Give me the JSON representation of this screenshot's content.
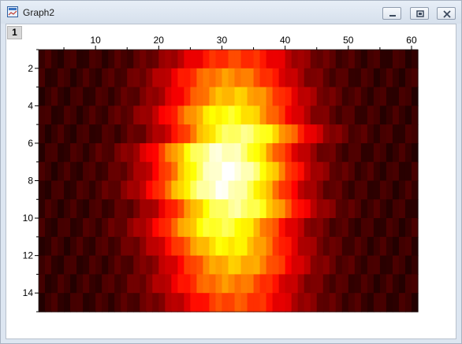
{
  "window": {
    "title": "Graph2",
    "layer_label": "1",
    "icon": "graph-window-icon",
    "buttons": [
      "minimize-icon",
      "restore-icon",
      "close-icon"
    ]
  },
  "chart_data": {
    "type": "heatmap",
    "title": "",
    "xlabel": "",
    "ylabel": "",
    "x_axis_position": "top",
    "y_axis_reversed": true,
    "xlim": [
      1,
      61
    ],
    "ylim": [
      1,
      15
    ],
    "x_ticks": [
      10,
      20,
      30,
      40,
      50,
      60
    ],
    "y_ticks": [
      2,
      4,
      6,
      8,
      10,
      12,
      14
    ],
    "colormap": "hot (black-red-yellow-white)",
    "cols": 60,
    "rows": 14,
    "peak": {
      "x": 31,
      "y": 8
    },
    "row_intensity": [
      0.42,
      0.55,
      0.64,
      0.75,
      0.86,
      0.95,
      1.0,
      0.97,
      0.88,
      0.8,
      0.72,
      0.63,
      0.54,
      0.45
    ],
    "row_center_offset": [
      1,
      0,
      1,
      0,
      2,
      -1,
      0,
      -1,
      1,
      -1,
      0,
      1,
      0,
      1
    ],
    "column_sigma": 7.5,
    "background_level": 0.08,
    "grid": false,
    "legend": "none"
  }
}
